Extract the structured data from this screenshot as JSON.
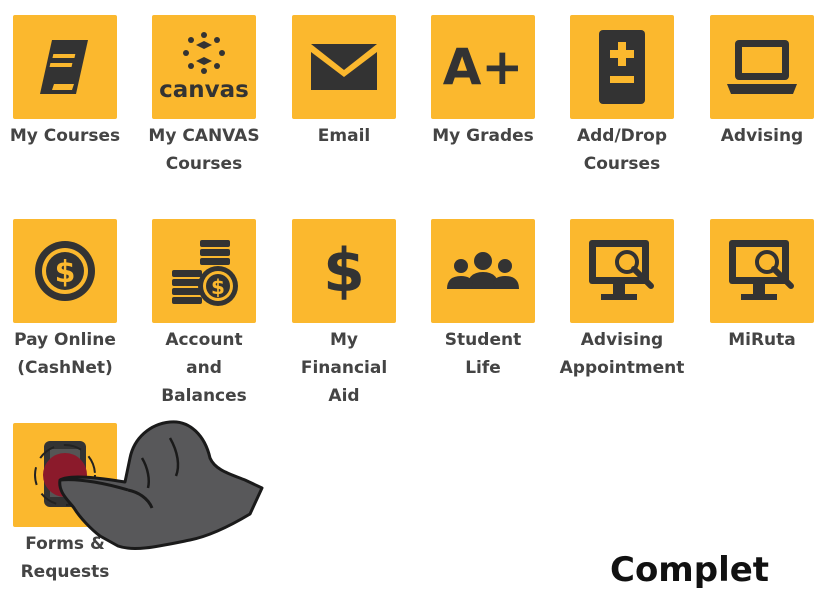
{
  "tiles": [
    {
      "label": "My Courses",
      "icon": "book-icon"
    },
    {
      "label": "My CANVAS\nCourses",
      "icon": "canvas-logo-icon",
      "icon_text": "canvas"
    },
    {
      "label": "Email",
      "icon": "envelope-icon"
    },
    {
      "label": "My Grades",
      "icon": "a-plus-icon",
      "icon_text": "A+"
    },
    {
      "label": "Add/Drop\nCourses",
      "icon": "plus-minus-document-icon"
    },
    {
      "label": "Advising",
      "icon": "laptop-icon"
    },
    {
      "label": "Pay Online\n(CashNet)",
      "icon": "dollar-coin-icon"
    },
    {
      "label": "Account\nand\nBalances",
      "icon": "coin-stack-icon"
    },
    {
      "label": "My\nFinancial\nAid",
      "icon": "dollar-sign-icon",
      "icon_text": "$"
    },
    {
      "label": "Student\nLife",
      "icon": "people-group-icon"
    },
    {
      "label": "Advising\nAppointment",
      "icon": "monitor-search-icon"
    },
    {
      "label": "MiRuta",
      "icon": "monitor-search-icon"
    },
    {
      "label": "Forms &\nRequests",
      "icon": "forms-icon"
    }
  ],
  "footer": {
    "text": "Complet"
  },
  "colors": {
    "tile": "#fbb82e",
    "icon": "#333333",
    "label": "#444444",
    "highlight": "#8b1a2b",
    "hand": "#58585a"
  }
}
